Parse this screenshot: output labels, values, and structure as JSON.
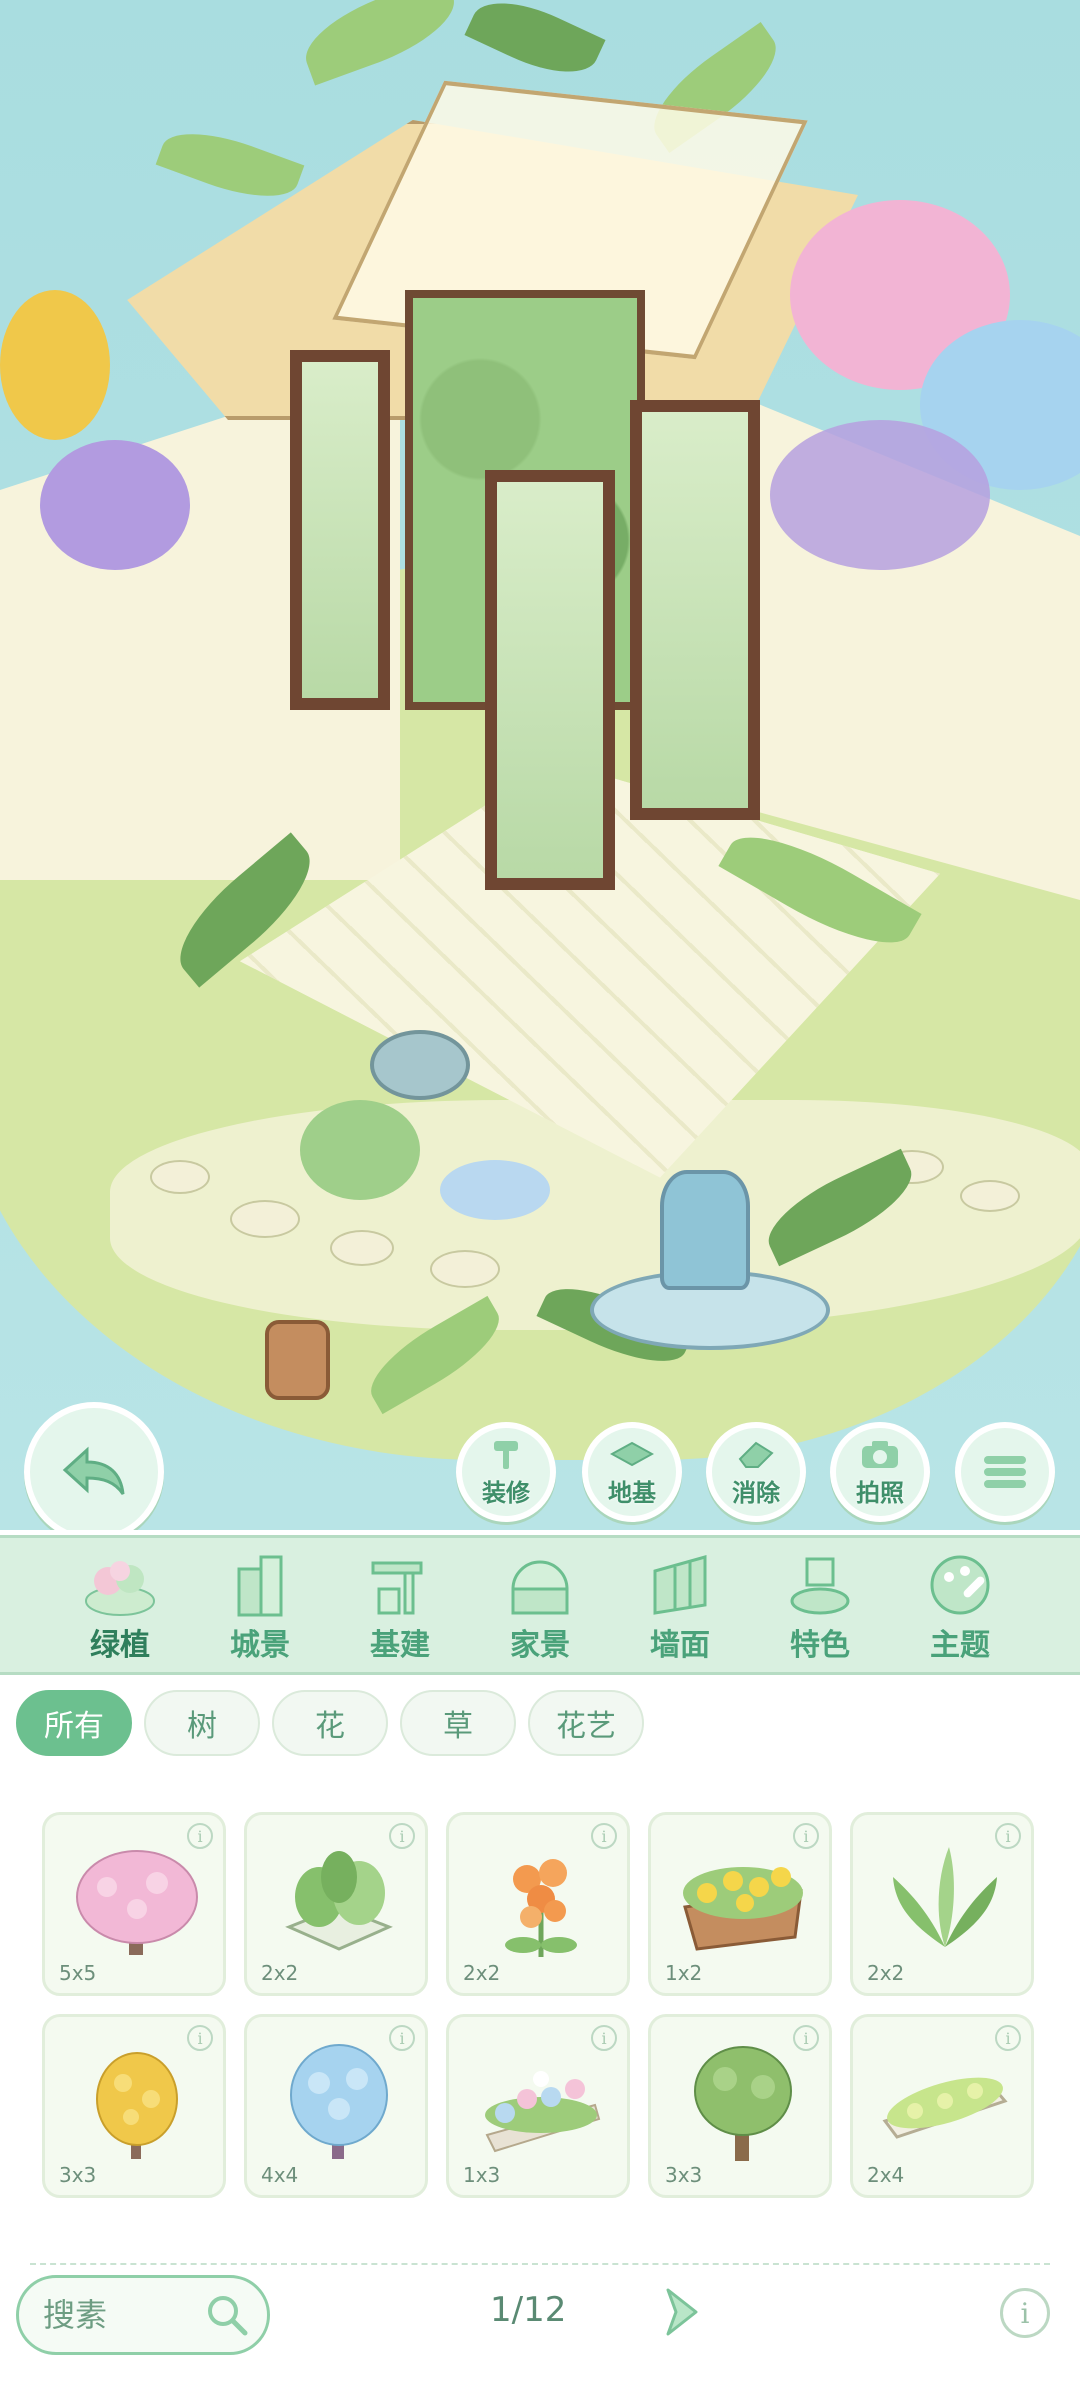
{
  "scene": {
    "tool_buttons": [
      {
        "label": "装修",
        "icon": "hammer-icon"
      },
      {
        "label": "地基",
        "icon": "foundation-icon"
      },
      {
        "label": "消除",
        "icon": "eraser-icon"
      },
      {
        "label": "拍照",
        "icon": "camera-icon"
      }
    ],
    "back_icon": "back-arrow-icon",
    "menu_icon": "menu-icon"
  },
  "categories": [
    {
      "label": "绿植",
      "icon": "plant-icon",
      "active": true
    },
    {
      "label": "城景",
      "icon": "building-icon",
      "active": false
    },
    {
      "label": "基建",
      "icon": "construction-icon",
      "active": false
    },
    {
      "label": "家景",
      "icon": "home-icon",
      "active": false
    },
    {
      "label": "墙面",
      "icon": "wall-icon",
      "active": false
    },
    {
      "label": "特色",
      "icon": "feature-icon",
      "active": false
    },
    {
      "label": "主题",
      "icon": "theme-palette-icon",
      "active": false
    }
  ],
  "filters": [
    {
      "label": "所有",
      "active": true
    },
    {
      "label": "树",
      "active": false
    },
    {
      "label": "花",
      "active": false
    },
    {
      "label": "草",
      "active": false
    },
    {
      "label": "花艺",
      "active": false
    }
  ],
  "items": [
    {
      "size": "5x5",
      "icon": "pink-blossom-tree-icon"
    },
    {
      "size": "2x2",
      "icon": "leafy-planter-icon"
    },
    {
      "size": "2x2",
      "icon": "orange-flower-icon"
    },
    {
      "size": "1x2",
      "icon": "yellow-flower-box-icon"
    },
    {
      "size": "2x2",
      "icon": "green-plant-icon"
    },
    {
      "size": "3x3",
      "icon": "yellow-tree-icon"
    },
    {
      "size": "4x4",
      "icon": "blue-tree-icon"
    },
    {
      "size": "1x3",
      "icon": "flower-planter-icon"
    },
    {
      "size": "3x3",
      "icon": "green-tree-icon"
    },
    {
      "size": "2x4",
      "icon": "hedge-box-icon"
    }
  ],
  "search": {
    "placeholder": "搜素",
    "icon": "search-icon"
  },
  "pager": {
    "text": "1/12",
    "next_icon": "chevron-right-icon"
  },
  "help": {
    "glyph": "i",
    "icon": "info-icon"
  },
  "colors": {
    "accent": "#6cc08f",
    "category_text": "#4aa27a",
    "sky": "#a9dde0"
  }
}
